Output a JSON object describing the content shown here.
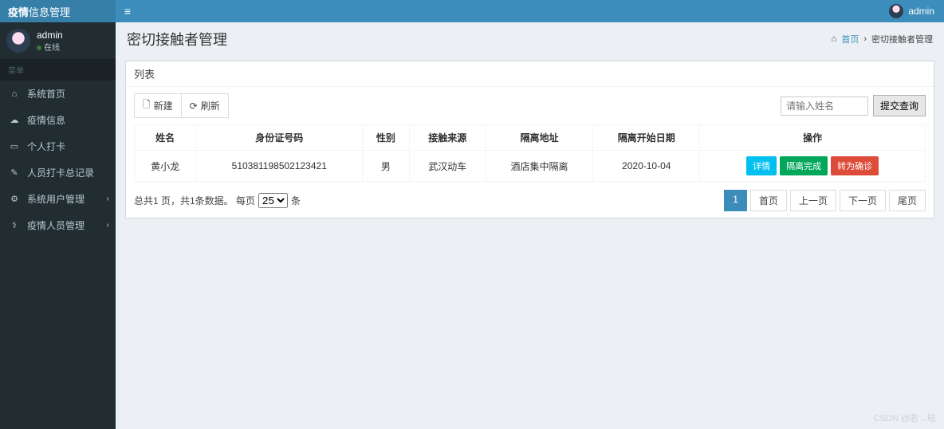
{
  "brand": {
    "bold": "疫情",
    "rest": "信息管理"
  },
  "top_user": "admin",
  "user_panel": {
    "name": "admin",
    "status": "在线"
  },
  "menu_header": "菜单",
  "nav": [
    {
      "icon": "⌂",
      "label": "系统首页",
      "expandable": false
    },
    {
      "icon": "☁",
      "label": "疫情信息",
      "expandable": false
    },
    {
      "icon": "▭",
      "label": "个人打卡",
      "expandable": false
    },
    {
      "icon": "✎",
      "label": "人员打卡总记录",
      "expandable": false
    },
    {
      "icon": "⚙",
      "label": "系统用户管理",
      "expandable": true
    },
    {
      "icon": "⚕",
      "label": "疫情人员管理",
      "expandable": true
    }
  ],
  "page_title": "密切接触者管理",
  "breadcrumb": {
    "home_icon": "⌂",
    "home": "首页",
    "current": "密切接触者管理"
  },
  "box_title": "列表",
  "toolbar": {
    "new_icon": "🗋",
    "new": "新建",
    "refresh_icon": "⟳",
    "refresh": "刷新"
  },
  "search": {
    "placeholder": "请输入姓名",
    "submit": "提交查询"
  },
  "table": {
    "headers": [
      "姓名",
      "身份证号码",
      "性别",
      "接触来源",
      "隔离地址",
      "隔离开始日期",
      "操作"
    ],
    "rows": [
      {
        "name": "黄小龙",
        "id": "510381198502123421",
        "gender": "男",
        "source": "武汉动车",
        "address": "酒店集中隔离",
        "date": "2020-10-04"
      }
    ],
    "ops": {
      "detail": "详情",
      "done": "隔离完成",
      "convert": "转为确诊"
    }
  },
  "pager": {
    "summary_a": "总共1 页，共1条数据。 每页",
    "summary_b": "条",
    "page_size": "25",
    "current": "1",
    "first": "首页",
    "prev": "上一页",
    "next": "下一页",
    "last": "尾页"
  },
  "watermark": "CSDN @若→晗"
}
